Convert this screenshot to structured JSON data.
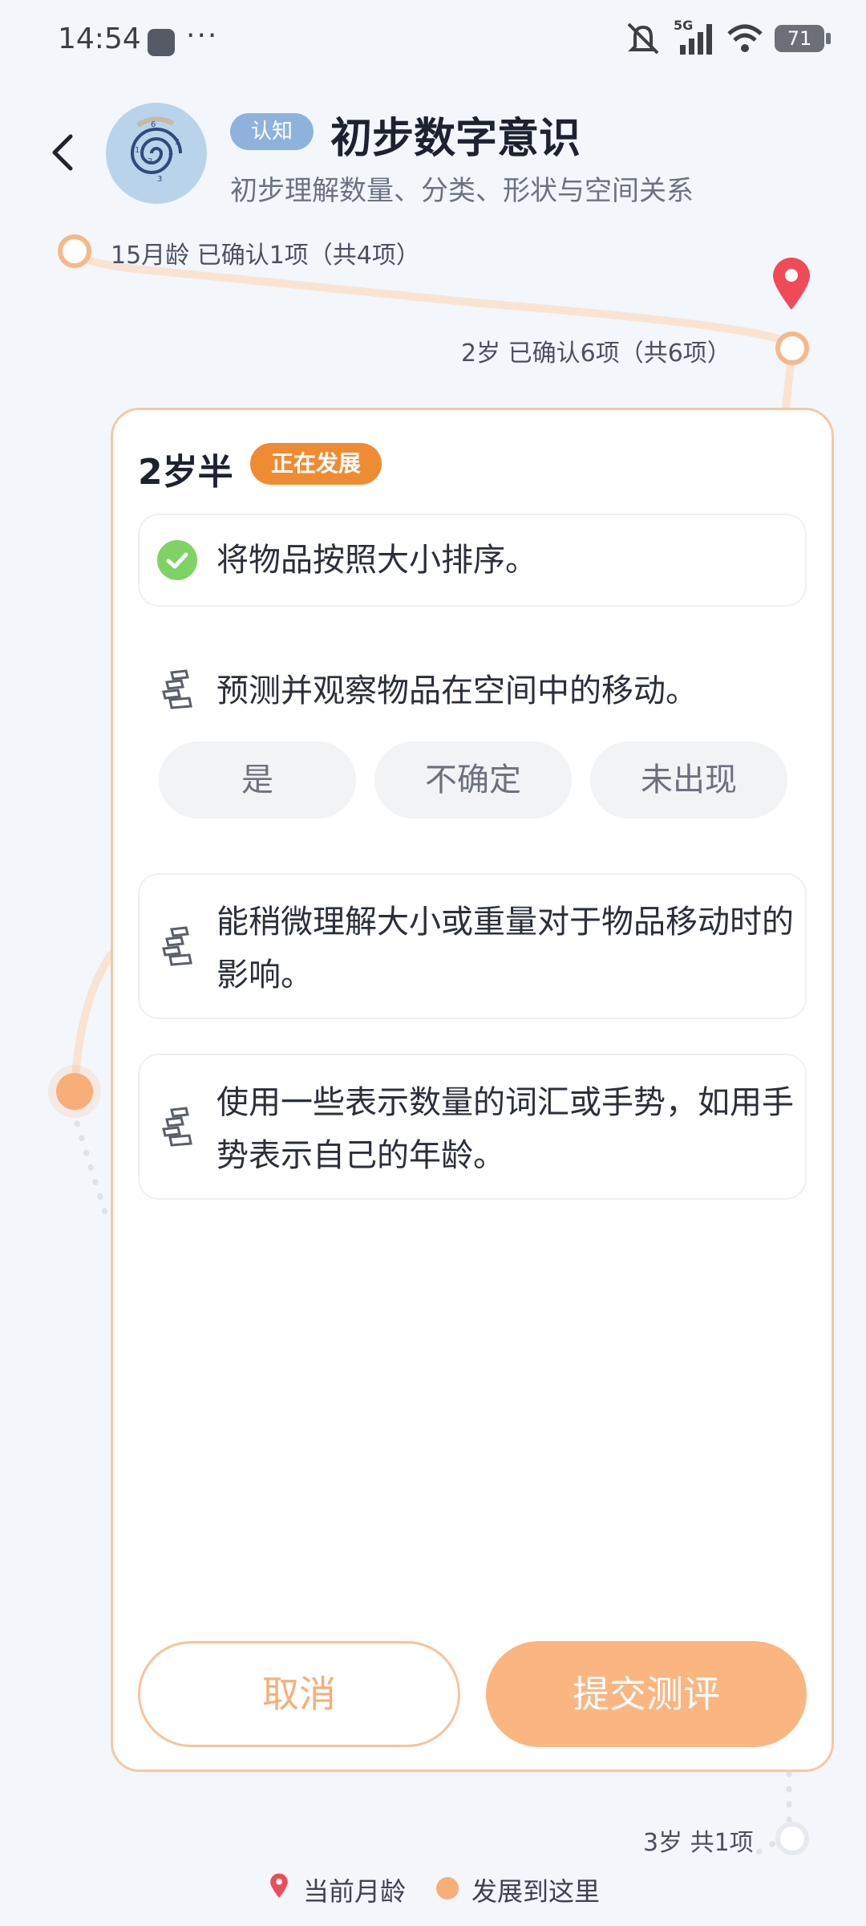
{
  "status_bar": {
    "time": "14:54",
    "dots": "···",
    "network": "5G",
    "battery": "71"
  },
  "header": {
    "tag": "认知",
    "title": "初步数字意识",
    "subtitle": "初步理解数量、分类、形状与空间关系"
  },
  "timeline": {
    "nodes": [
      {
        "label": "15月龄 已确认1项（共4项）"
      },
      {
        "label": "2岁 已确认6项（共6项）"
      },
      {
        "label": "3岁 共1项"
      }
    ]
  },
  "card": {
    "age": "2岁半",
    "status": "正在发展",
    "items": [
      {
        "text": "将物品按照大小排序。",
        "confirmed": true
      },
      {
        "text": "预测并观察物品在空间中的移动。",
        "confirmed": false
      },
      {
        "text": "能稍微理解大小或重量对于物品移动时的影响。",
        "confirmed": false
      },
      {
        "text": "使用一些表示数量的词汇或手势，如用手势表示自己的年龄。",
        "confirmed": false
      }
    ],
    "options": [
      "是",
      "不确定",
      "未出现"
    ],
    "cancel": "取消",
    "submit": "提交测评"
  },
  "legend": {
    "current": "当前月龄",
    "reached": "发展到这里"
  },
  "colors": {
    "accent": "#F8AE78",
    "badge": "#EF8B33",
    "tag": "#8FB2DC",
    "pin": "#EF4B57",
    "check": "#7DD364"
  }
}
